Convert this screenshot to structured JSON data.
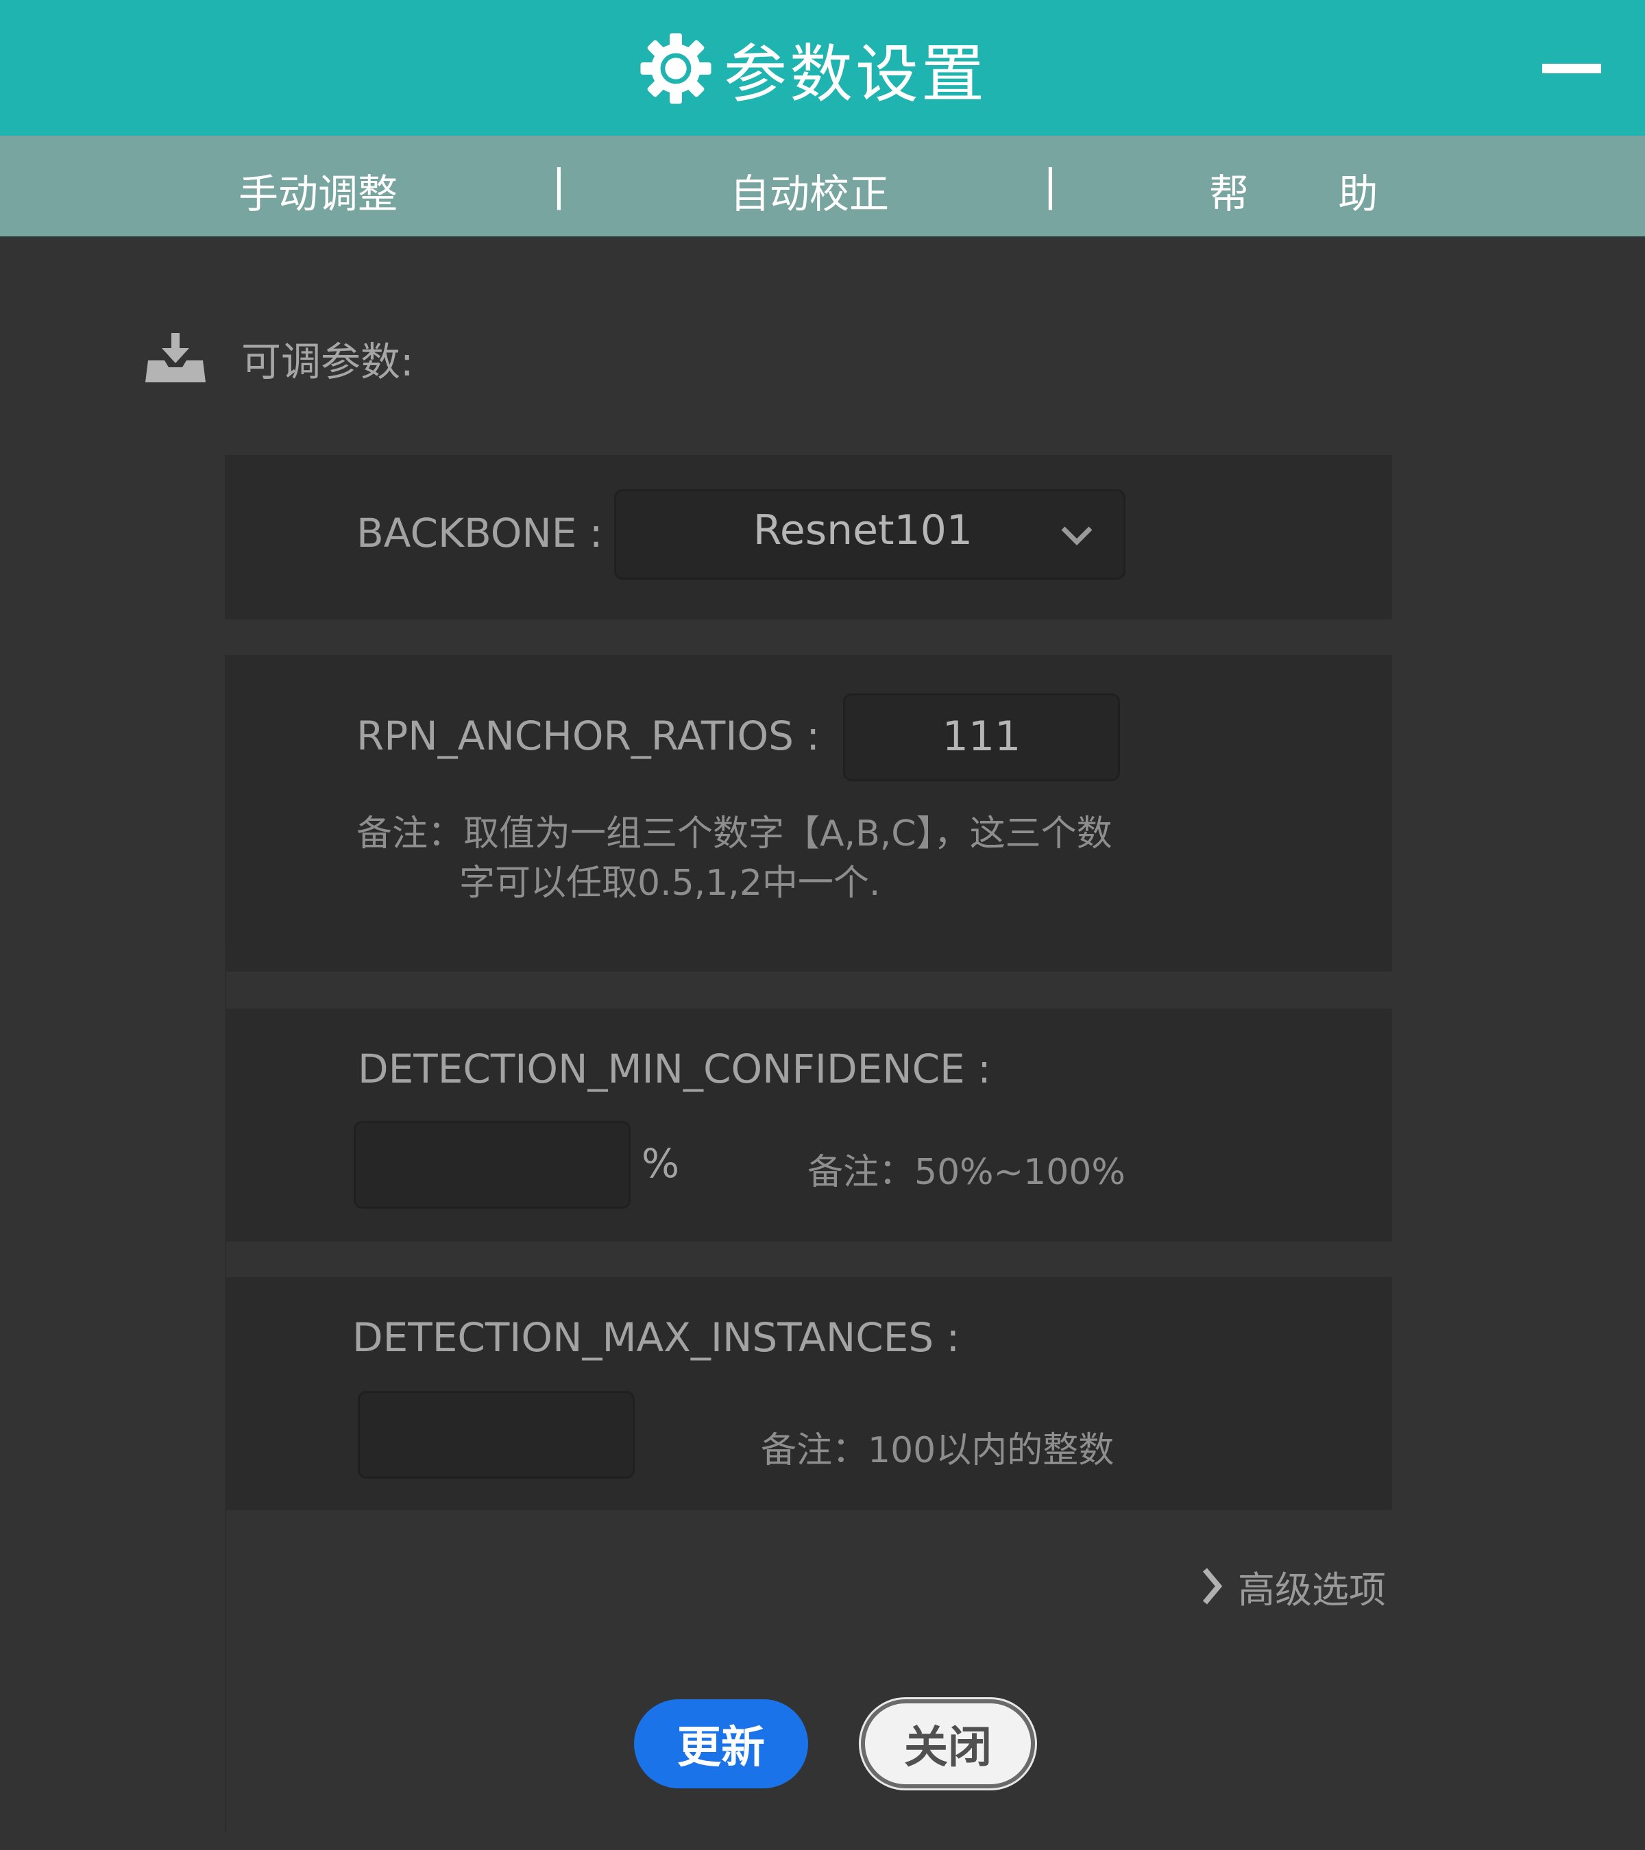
{
  "window": {
    "title": "参数设置",
    "title_icon": "gear-icon",
    "minimize_icon": "minimize-icon"
  },
  "tabs": [
    {
      "label": "手动调整"
    },
    {
      "label": "自动校正"
    },
    {
      "label": "帮 助"
    }
  ],
  "tab_separator": "|",
  "section": {
    "icon": "download-tray-icon",
    "title": "可调参数:"
  },
  "params": {
    "backbone": {
      "label": "BACKBONE :",
      "value": "Resnet101",
      "icon": "chevron-down-icon"
    },
    "rpn_anchor_ratios": {
      "label": "RPN_ANCHOR_RATIOS :",
      "value": "111",
      "note_line1": "备注：取值为一组三个数字【A,B,C】，这三个数",
      "note_line2": "字可以任取0.5,1,2中一个."
    },
    "detection_min_confidence": {
      "label": "DETECTION_MIN_CONFIDENCE :",
      "value": "",
      "unit": "%",
      "note": "备注：50%~100%"
    },
    "detection_max_instances": {
      "label": "DETECTION_MAX_INSTANCES :",
      "value": "",
      "note": "备注：100以内的整数"
    }
  },
  "advanced": {
    "label": "高级选项",
    "icon": "chevron-right-icon"
  },
  "buttons": {
    "update": "更新",
    "close": "关闭"
  },
  "colors": {
    "titlebar": "#1fb4b0",
    "tabbar": "#79a5a0",
    "background": "#333333",
    "panel": "#2b2b2b",
    "primary_button": "#1a73e8"
  }
}
